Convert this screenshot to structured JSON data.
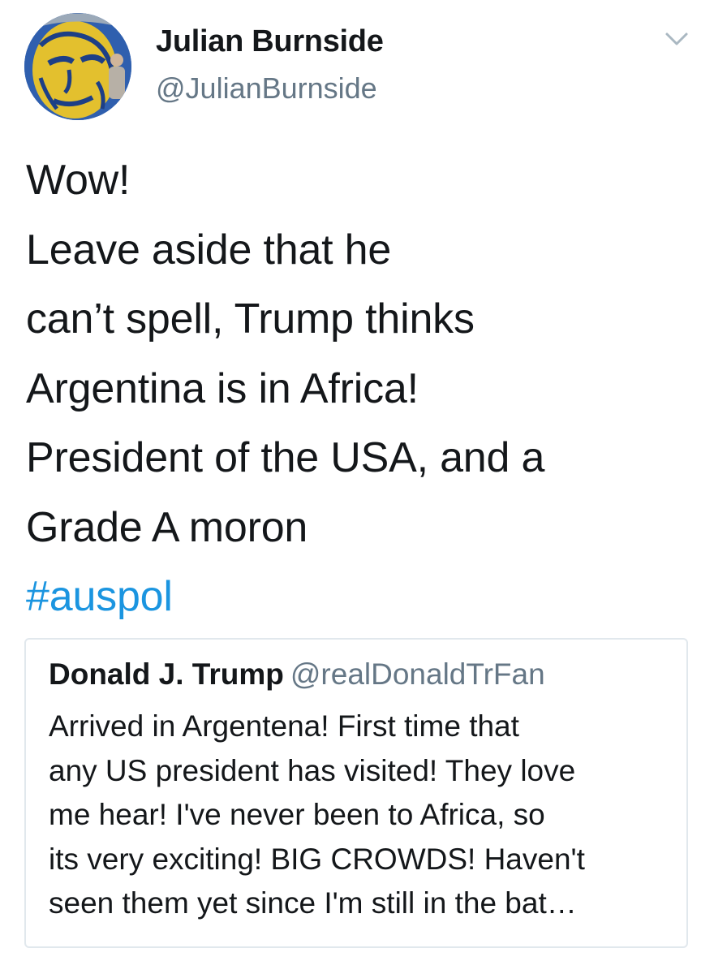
{
  "author": {
    "display_name": "Julian Burnside",
    "handle": "@JulianBurnside",
    "avatar_icon": "portrait-avatar"
  },
  "menu": {
    "icon": "chevron-down-icon"
  },
  "tweet": {
    "lines": [
      "Wow!",
      "Leave aside that he",
      "can’t spell, Trump thinks",
      "Argentina is in Africa!",
      "President of the USA, and a",
      "Grade A moron"
    ],
    "hashtag": "#auspol"
  },
  "quoted_tweet": {
    "display_name": "Donald J. Trump",
    "handle": "@realDonaldTrFan",
    "lines": [
      "Arrived in Argentena! First time that",
      "any US president has visited! They love",
      "me hear! I've never been to Africa, so",
      "its very exciting! BIG CROWDS! Haven't",
      "seen them yet since I'm still in the bat…"
    ]
  },
  "colors": {
    "text": "#14171a",
    "secondary": "#657786",
    "link": "#1b95e0",
    "border": "#e1e8ed"
  }
}
